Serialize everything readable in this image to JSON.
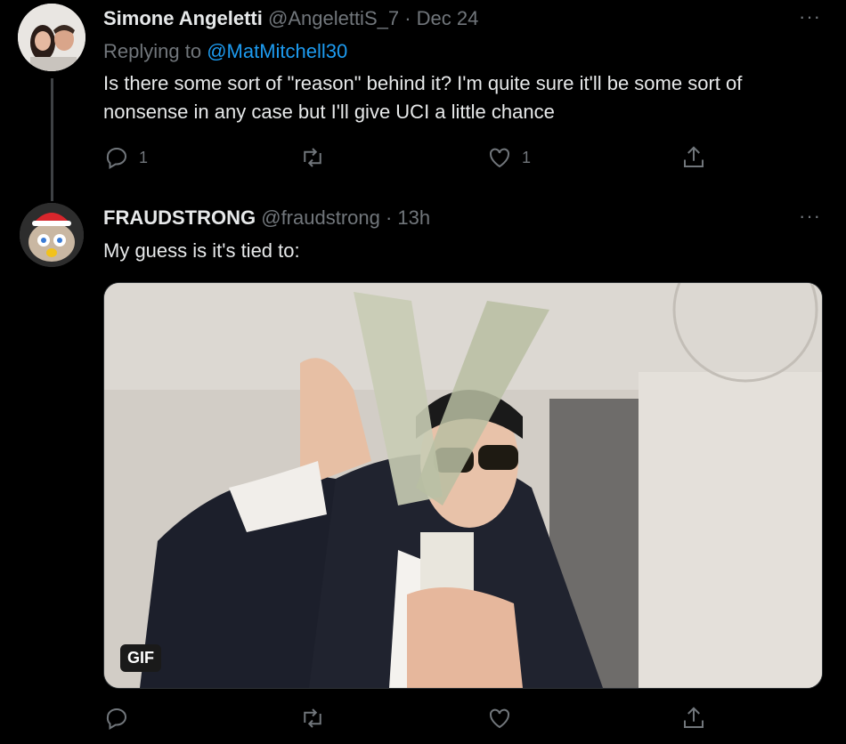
{
  "tweets": [
    {
      "name": "Simone Angeletti",
      "handle": "@AngelettiS_7",
      "time": "· Dec 24",
      "reply_prefix": "Replying to",
      "reply_mention": "@MatMitchell30",
      "text": "Is there some sort of \"reason\" behind it? I'm quite sure it'll be some sort of nonsense in any case but I'll give UCI a little chance",
      "reply_count": "1",
      "like_count": "1"
    },
    {
      "name": "FRAUDSTRONG",
      "handle": "@fraudstrong",
      "time": "· 13h",
      "text": "My guess is it's tied to:",
      "media_badge": "GIF"
    }
  ],
  "more_label": "···",
  "icons": {
    "reply": "reply-icon",
    "retweet": "retweet-icon",
    "like": "heart-icon",
    "share": "share-icon",
    "more": "more-icon"
  },
  "colors": {
    "background": "#000000",
    "text": "#e7e9ea",
    "muted": "#71767b",
    "link": "#1d9bf0"
  }
}
